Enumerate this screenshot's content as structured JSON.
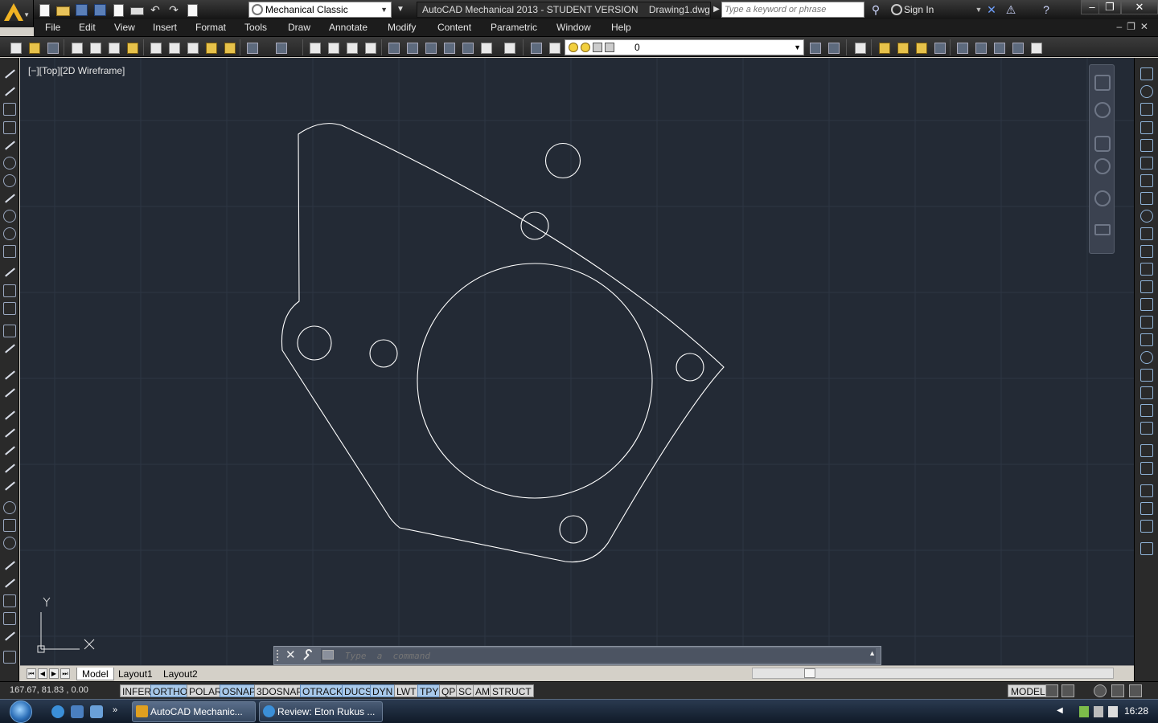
{
  "window": {
    "title": "AutoCAD Mechanical 2013 - STUDENT VERSION    Drawing1.dwg",
    "workspace": "Mechanical Classic",
    "search_placeholder": "Type a keyword or phrase",
    "sign_in": "Sign In"
  },
  "menu": [
    "File",
    "Edit",
    "View",
    "Insert",
    "Format",
    "Tools",
    "Draw",
    "Annotate",
    "Modify",
    "Content",
    "Parametric",
    "Window",
    "Help"
  ],
  "layer": {
    "name": "0"
  },
  "viewport": {
    "label": "[−][Top][2D Wireframe]",
    "ucs_y": "Y",
    "ucs_x": "X",
    "colors": {
      "background": "#232a35",
      "grid": "#2e3644",
      "geometry": "#ffffff"
    }
  },
  "command_line": {
    "placeholder": "Type  a  command"
  },
  "layout_tabs": [
    "Model",
    "Layout1",
    "Layout2"
  ],
  "status": {
    "coords": "167.67, 81.83 , 0.00",
    "toggles": [
      {
        "label": "INFER",
        "on": false
      },
      {
        "label": "ORTHO",
        "on": true
      },
      {
        "label": "POLAR",
        "on": false
      },
      {
        "label": "OSNAP",
        "on": true
      },
      {
        "label": "3DOSNAP",
        "on": false
      },
      {
        "label": "OTRACK",
        "on": true
      },
      {
        "label": "DUCS",
        "on": true
      },
      {
        "label": "DYN",
        "on": true
      },
      {
        "label": "LWT",
        "on": false
      },
      {
        "label": "TPY",
        "on": true
      },
      {
        "label": "QP",
        "on": false
      },
      {
        "label": "SC",
        "on": false
      },
      {
        "label": "AM",
        "on": false
      },
      {
        "label": "STRUCT",
        "on": false
      }
    ],
    "space": "MODEL"
  },
  "taskbar": {
    "tasks": [
      "AutoCAD Mechanic...",
      "Review: Eton Rukus ..."
    ],
    "clock": "16:28"
  }
}
